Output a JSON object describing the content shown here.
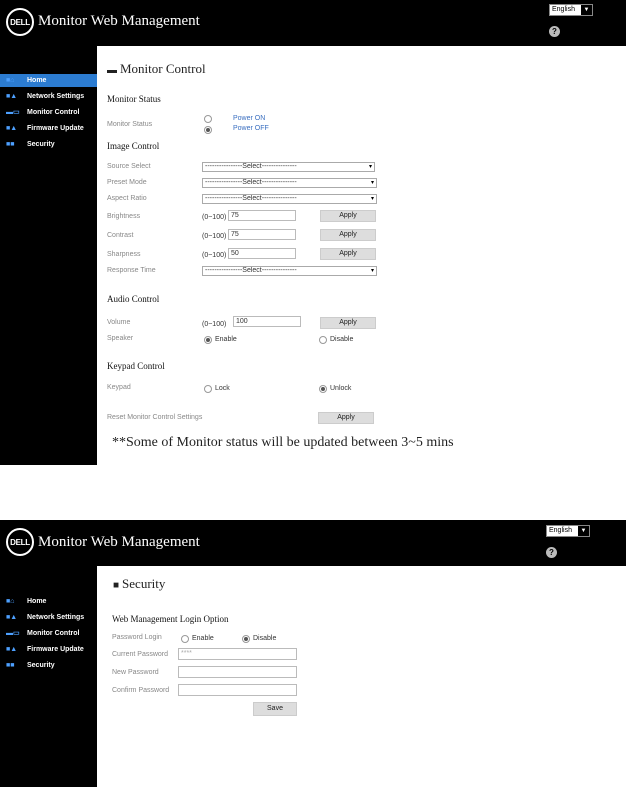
{
  "header": {
    "logo_text": "DELL",
    "title": "Monitor Web Management",
    "language": "English",
    "help_icon": "?"
  },
  "sidebar": {
    "items": [
      {
        "label": "Home",
        "icon": "home-icon"
      },
      {
        "label": "Network Settings",
        "icon": "network-icon"
      },
      {
        "label": "Monitor Control",
        "icon": "monitor-icon"
      },
      {
        "label": "Firmware Update",
        "icon": "upload-icon"
      },
      {
        "label": "Security",
        "icon": "lock-icon"
      }
    ]
  },
  "monitor_control": {
    "page_title": "Monitor Control",
    "status_section": "Monitor Status",
    "status_label": "Monitor Status",
    "power_on": "Power ON",
    "power_off": "Power OFF",
    "image_section": "Image Control",
    "source_label": "Source Select",
    "preset_label": "Preset Mode",
    "aspect_label": "Aspect Ratio",
    "select_placeholder": "----------------Select---------------",
    "brightness_label": "Brightness",
    "contrast_label": "Contrast",
    "sharpness_label": "Sharpness",
    "response_label": "Response Time",
    "range": "(0~100)",
    "brightness_value": "75",
    "contrast_value": "75",
    "sharpness_value": "50",
    "apply": "Apply",
    "audio_section": "Audio Control",
    "volume_label": "Volume",
    "volume_value": "100",
    "speaker_label": "Speaker",
    "enable": "Enable",
    "disable": "Disable",
    "keypad_section": "Keypad Control",
    "keypad_label": "Keypad",
    "lock": "Lock",
    "unlock": "Unlock",
    "reset_label": "Reset Monitor Control Settings",
    "note": "**Some of Monitor status will be updated between 3~5 mins"
  },
  "security": {
    "page_title": "Security",
    "section": "Web Management Login Option",
    "password_login_label": "Password Login",
    "enable": "Enable",
    "disable": "Disable",
    "current_password_label": "Current Password",
    "current_password_value": "****",
    "new_password_label": "New Password",
    "confirm_password_label": "Confirm Password",
    "save": "Save"
  },
  "colors": {
    "active_nav": "#2c7cd1",
    "header_bg": "#000000",
    "link_blue": "#3a6fc0"
  }
}
